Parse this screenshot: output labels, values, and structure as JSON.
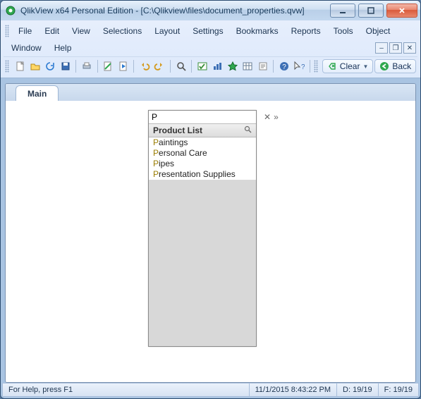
{
  "title": "QlikView x64 Personal Edition - [C:\\Qlikview\\files\\document_properties.qvw]",
  "menu": {
    "row1": [
      "File",
      "Edit",
      "View",
      "Selections",
      "Layout",
      "Settings",
      "Bookmarks",
      "Reports",
      "Tools",
      "Object"
    ],
    "row2": [
      "Window",
      "Help"
    ]
  },
  "toolbar": {
    "clear_label": "Clear",
    "back_label": "Back"
  },
  "tabs": {
    "main": "Main"
  },
  "listbox": {
    "search_value": "P",
    "header": "Product List",
    "items": [
      "Paintings",
      "Personal Care",
      "Pipes",
      "Presentation Supplies"
    ]
  },
  "status": {
    "help": "For Help, press F1",
    "datetime": "11/1/2015 8:43:22 PM",
    "d": "D: 19/19",
    "f": "F: 19/19"
  }
}
